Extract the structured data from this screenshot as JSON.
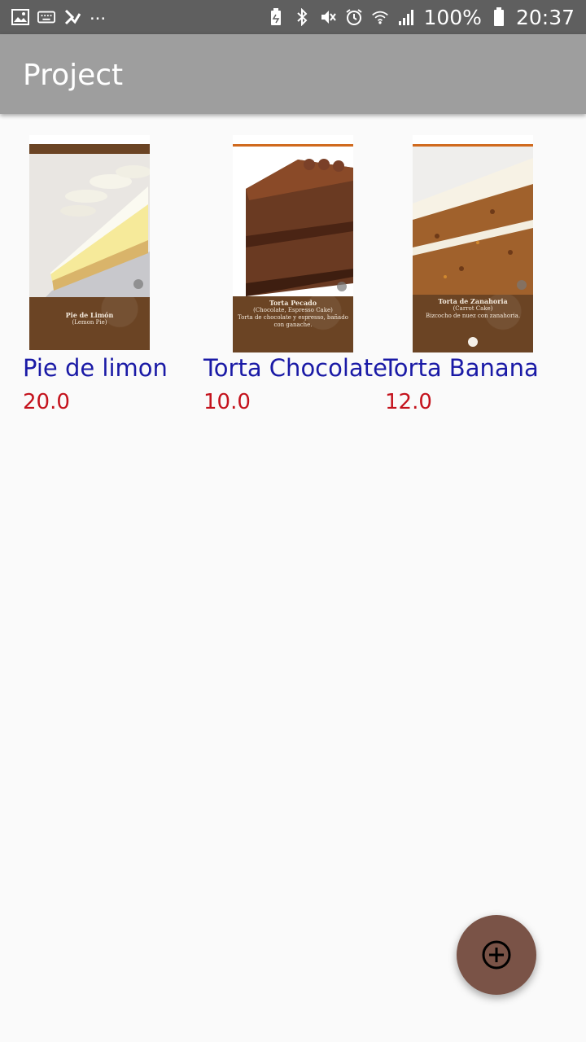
{
  "status_bar": {
    "battery_percent": "100%",
    "time": "20:37",
    "overflow": "...",
    "icons_left": [
      "image-icon",
      "keyboard-icon",
      "check-flag-icon"
    ],
    "icons_right": [
      "battery-saver-icon",
      "bluetooth-icon",
      "mute-icon",
      "alarm-icon",
      "wifi-icon",
      "signal-icon",
      "battery-icon"
    ]
  },
  "app_bar": {
    "title": "Project"
  },
  "products": [
    {
      "name": "Pie de limon",
      "price": "20.0",
      "thumb_title": "Pie de Limón",
      "thumb_subtitle": "(Lemon Pie)",
      "thumb_desc": ""
    },
    {
      "name": "Torta Chocolate",
      "price": "10.0",
      "thumb_title": "Torta Pecado",
      "thumb_subtitle": "(Chocolate, Espresso Cake)",
      "thumb_desc": "Torta de chocolate y espresso, bañado con ganache."
    },
    {
      "name": "Torta Banana",
      "price": "12.0",
      "thumb_title": "Torta de Zanahoria",
      "thumb_subtitle": "(Carrot Cake)",
      "thumb_desc": "Bizcocho de nuez con zanahoria."
    }
  ],
  "fab": {
    "icon": "add-circle-icon",
    "color": "#7a5347"
  },
  "colors": {
    "name_text": "#1a1aa6",
    "price_text": "#c4121c",
    "app_bar": "#9e9e9e",
    "status_bar": "#5f5f5f"
  }
}
